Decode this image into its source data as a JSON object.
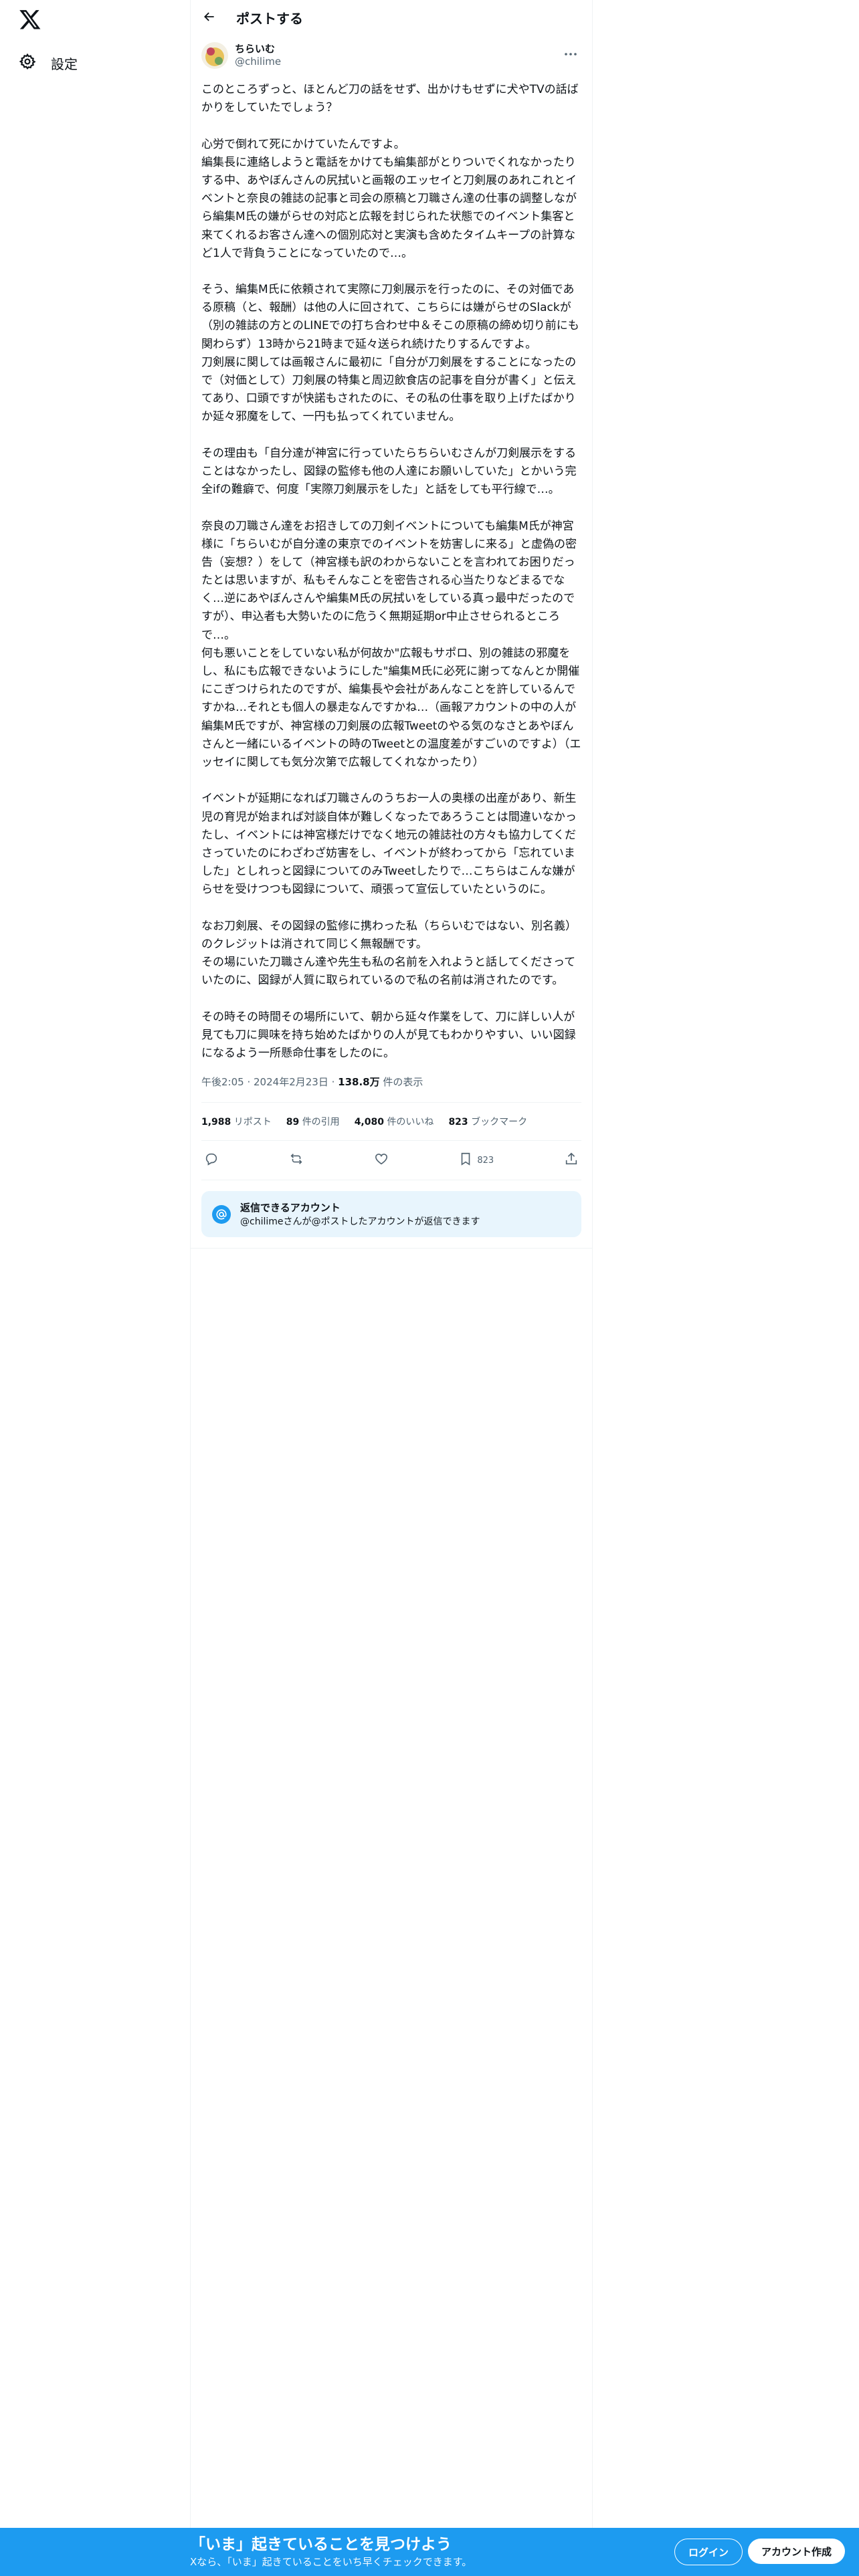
{
  "nav": {
    "settings_label": "設定"
  },
  "header": {
    "title": "ポストする"
  },
  "post": {
    "author_name": "ちらいむ",
    "author_handle": "@chilime",
    "body": "このところずっと、ほとんど刀の話をせず、出かけもせずに犬やTVの話ばかりをしていたでしょう？\n\n心労で倒れて死にかけていたんですよ。\n編集長に連絡しようと電話をかけても編集部がとりついでくれなかったりする中、あやぼんさんの尻拭いと画報のエッセイと刀剣展のあれこれとイベントと奈良の雑誌の記事と司会の原稿と刀職さん達の仕事の調整しながら編集M氏の嫌がらせの対応と広報を封じられた状態でのイベント集客と来てくれるお客さん達への個別応対と実演も含めたタイムキープの計算など1人で背負うことになっていたので…。\n\nそう、編集M氏に依頼されて実際に刀剣展示を行ったのに、その対価である原稿（と、報酬）は他の人に回されて、こちらには嫌がらせのSlackが（別の雑誌の方とのLINEでの打ち合わせ中＆そこの原稿の締め切り前にも関わらず）13時から21時まで延々送られ続けたりするんですよ。\n刀剣展に関しては画報さんに最初に「自分が刀剣展をすることになったので（対価として）刀剣展の特集と周辺飲食店の記事を自分が書く」と伝えてあり、口頭ですが快諾もされたのに、その私の仕事を取り上げたばかりか延々邪魔をして、一円も払ってくれていません。\n\nその理由も「自分達が神宮に行っていたらちらいむさんが刀剣展示をすることはなかったし、図録の監修も他の人達にお願いしていた」とかいう完全ifの難癖で、何度「実際刀剣展示をした」と話をしても平行線で…。\n\n奈良の刀職さん達をお招きしての刀剣イベントについても編集M氏が神宮様に「ちらいむが自分達の東京でのイベントを妨害しに来る」と虚偽の密告（妄想？）をして（神宮様も訳のわからないことを言われてお困りだったとは思いますが、私もそんなことを密告される心当たりなどまるでなく…逆にあやぼんさんや編集M氏の尻拭いをしている真っ最中だったのですが）、申込者も大勢いたのに危うく無期延期or中止させられるところで…。\n何も悪いことをしていない私が何故か\"広報もサポロ、別の雑誌の邪魔をし、私にも広報できないようにした\"編集M氏に必死に謝ってなんとか開催にこぎつけられたのですが、編集長や会社があんなことを許しているんですかね…それとも個人の暴走なんですかね…（画報アカウントの中の人が編集M氏ですが、神宮様の刀剣展の広報Tweetのやる気のなさとあやぼんさんと一緒にいるイベントの時のTweetとの温度差がすごいのですよ）（エッセイに関しても気分次第で広報してくれなかったり）\n\nイベントが延期になれば刀職さんのうちお一人の奥様の出産があり、新生児の育児が始まれば対談自体が難しくなったであろうことは間違いなかったし、イベントには神宮様だけでなく地元の雑誌社の方々も協力してくださっていたのにわざわざ妨害をし、イベントが終わってから「忘れていました」としれっと図録についてのみTweetしたりで…こちらはこんな嫌がらせを受けつつも図録について、頑張って宣伝していたというのに。\n\nなお刀剣展、その図録の監修に携わった私（ちらいむではない、別名義）のクレジットは消されて同じく無報酬です。\nその場にいた刀職さん達や先生も私の名前を入れようと話してくださっていたのに、図録が人質に取られているので私の名前は消されたのです。\n\nその時その時間その場所にいて、朝から延々作業をして、刀に詳しい人が見ても刀に興味を持ち始めたばかりの人が見てもわかりやすい、いい図録になるよう一所懸命仕事をしたのに。",
    "time": "午後2:05",
    "date": "2024年2月23日",
    "views_count": "138.8万",
    "views_label": "件の表示"
  },
  "stats": {
    "reposts_count": "1,988",
    "reposts_label": "リポスト",
    "quotes_count": "89",
    "quotes_label": "件の引用",
    "likes_count": "4,080",
    "likes_label": "件のいいね",
    "bookmarks_count": "823",
    "bookmarks_label": "ブックマーク"
  },
  "actions": {
    "bookmark_count": "823"
  },
  "reply_notice": {
    "title": "返信できるアカウント",
    "subtitle": "@chilimeさんが@ポストしたアカウントが返信できます"
  },
  "banner": {
    "title": "「いま」起きていることを見つけよう",
    "subtitle": "Xなら、「いま」起きていることをいち早くチェックできます。",
    "login_label": "ログイン",
    "signup_label": "アカウント作成"
  },
  "colors": {
    "accent": "#1d9bf0",
    "text": "#0f1419",
    "muted": "#536471"
  }
}
